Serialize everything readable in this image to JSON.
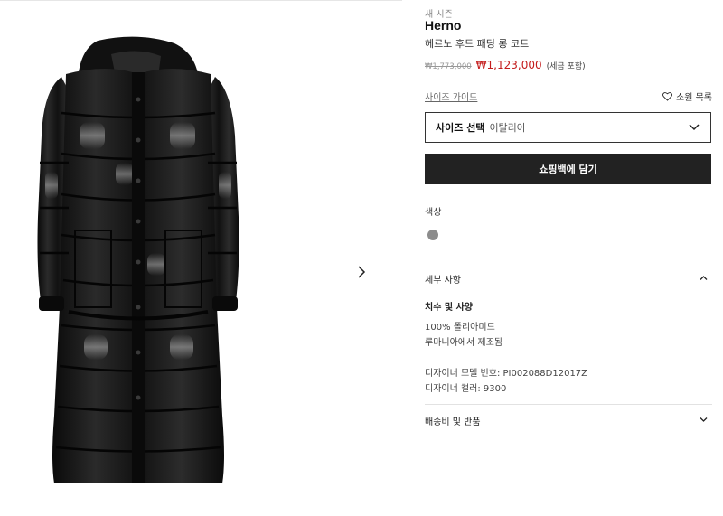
{
  "product": {
    "season_tag": "새 시즌",
    "brand": "Herno",
    "name": "헤르노 후드 패딩 롱 코트",
    "original_price": "₩1,773,000",
    "sale_price": "₩1,123,000",
    "tax_note": "(세금 포함)",
    "image_alt": "black glossy long padded coat"
  },
  "actions": {
    "size_guide_label": "사이즈 가이드",
    "wishlist_label": "소원 목록",
    "size_select_label": "사이즈 선택",
    "size_select_value": "이탈리아",
    "add_to_bag_label": "쇼핑백에 담기"
  },
  "color": {
    "section_label": "색상",
    "swatch_hex": "#8c8c8c"
  },
  "details": {
    "section_title": "세부 사항",
    "expanded": true,
    "subtitle": "치수 및 사양",
    "material": "100% 폴리아미드",
    "origin": "루마니아에서 제조됨",
    "model_number": "디자이너 모델 번호: PI002088D12017Z",
    "color_code": "디자이너 컬러: 9300"
  },
  "shipping": {
    "section_title": "배송비 및 반품",
    "expanded": false
  },
  "colors": {
    "sale_red": "#c41c1c",
    "button_dark": "#222222"
  }
}
